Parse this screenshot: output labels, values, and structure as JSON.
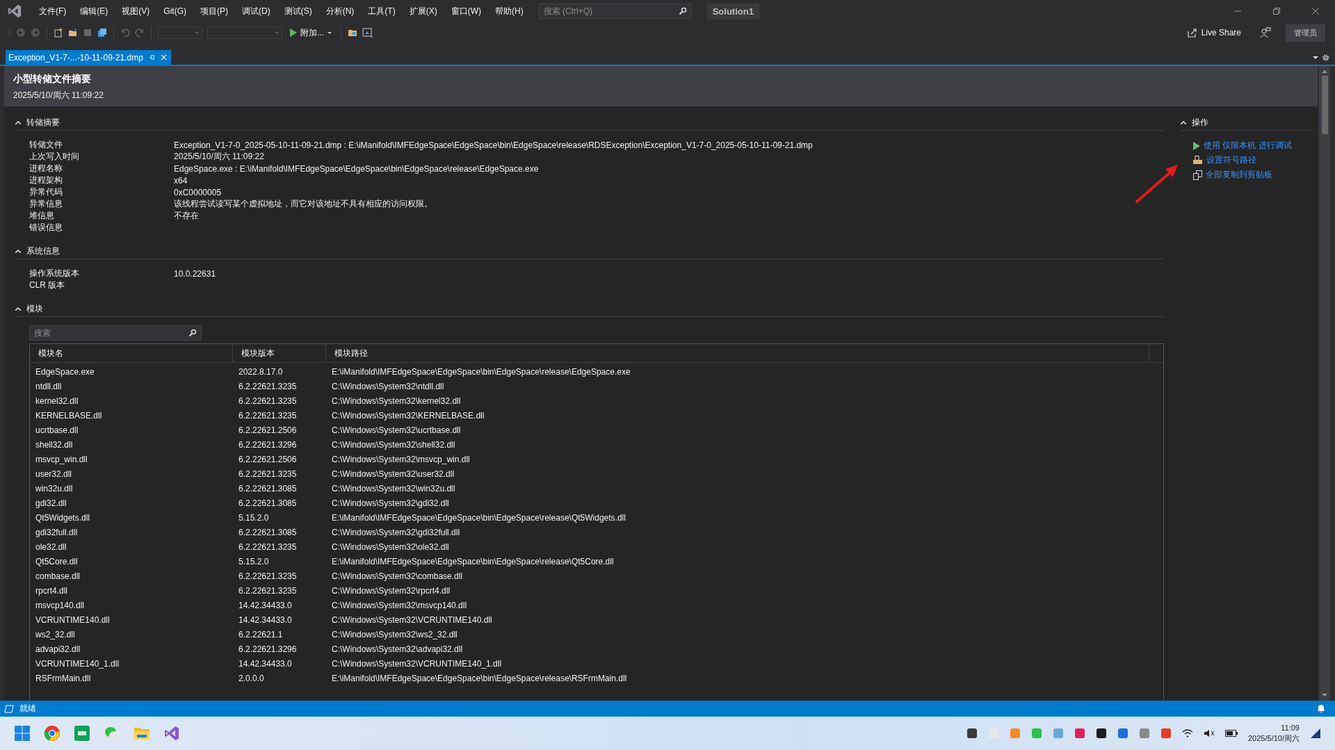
{
  "menu": [
    "文件(F)",
    "编辑(E)",
    "视图(V)",
    "Git(G)",
    "项目(P)",
    "调试(D)",
    "测试(S)",
    "分析(N)",
    "工具(T)",
    "扩展(X)",
    "窗口(W)",
    "帮助(H)"
  ],
  "search": {
    "placeholder": "搜索 (Ctrl+Q)"
  },
  "solution": "Solution1",
  "toolbar": {
    "attach": "附加..."
  },
  "live_share": "Live Share",
  "admin": "管理员",
  "tabs": [
    {
      "label": "Exception_V1-7-...-10-11-09-21.dmp",
      "selected": true
    }
  ],
  "header": {
    "title": "小型转储文件摘要",
    "time": "2025/5/10/周六 11:09:22"
  },
  "sections": [
    {
      "title": "转储摘要",
      "expanded": true,
      "fields": [
        {
          "label": "转储文件",
          "value": "Exception_V1-7-0_2025-05-10-11-09-21.dmp : E:\\iManifold\\IMFEdgeSpace\\EdgeSpace\\bin\\EdgeSpace\\release\\RDSException\\Exception_V1-7-0_2025-05-10-11-09-21.dmp"
        },
        {
          "label": "上次写入时间",
          "value": "2025/5/10/周六 11:09:22"
        },
        {
          "label": "进程名称",
          "value": "EdgeSpace.exe : E:\\iManifold\\IMFEdgeSpace\\EdgeSpace\\bin\\EdgeSpace\\release\\EdgeSpace.exe"
        },
        {
          "label": "进程架构",
          "value": "x64"
        },
        {
          "label": "异常代码",
          "value": "0xC0000005"
        },
        {
          "label": "异常信息",
          "value": "该线程尝试读写某个虚拟地址，而它对该地址不具有相应的访问权限。"
        },
        {
          "label": "堆信息",
          "value": "不存在"
        },
        {
          "label": "错误信息"
        }
      ]
    },
    {
      "title": "系统信息",
      "expanded": true,
      "fields": [
        {
          "label": "操作系统版本",
          "value": "10.0.22631"
        },
        {
          "label": "CLR 版本"
        }
      ]
    }
  ],
  "modules": {
    "title": "模块",
    "expanded": true,
    "search_placeholder": "搜索",
    "columns": [
      "模块名",
      "模块版本",
      "模块路径"
    ],
    "rows": [
      [
        "EdgeSpace.exe",
        "2022.8.17.0",
        "E:\\iManifold\\IMFEdgeSpace\\EdgeSpace\\bin\\EdgeSpace\\release\\EdgeSpace.exe"
      ],
      [
        "ntdll.dll",
        "6.2.22621.3235",
        "C:\\Windows\\System32\\ntdll.dll"
      ],
      [
        "kernel32.dll",
        "6.2.22621.3235",
        "C:\\Windows\\System32\\kernel32.dll"
      ],
      [
        "KERNELBASE.dll",
        "6.2.22621.3235",
        "C:\\Windows\\System32\\KERNELBASE.dll"
      ],
      [
        "ucrtbase.dll",
        "6.2.22621.2506",
        "C:\\Windows\\System32\\ucrtbase.dll"
      ],
      [
        "shell32.dll",
        "6.2.22621.3296",
        "C:\\Windows\\System32\\shell32.dll"
      ],
      [
        "msvcp_win.dll",
        "6.2.22621.2506",
        "C:\\Windows\\System32\\msvcp_win.dll"
      ],
      [
        "user32.dll",
        "6.2.22621.3235",
        "C:\\Windows\\System32\\user32.dll"
      ],
      [
        "win32u.dll",
        "6.2.22621.3085",
        "C:\\Windows\\System32\\win32u.dll"
      ],
      [
        "gdi32.dll",
        "6.2.22621.3085",
        "C:\\Windows\\System32\\gdi32.dll"
      ],
      [
        "Qt5Widgets.dll",
        "5.15.2.0",
        "E:\\iManifold\\IMFEdgeSpace\\EdgeSpace\\bin\\EdgeSpace\\release\\Qt5Widgets.dll"
      ],
      [
        "gdi32full.dll",
        "6.2.22621.3085",
        "C:\\Windows\\System32\\gdi32full.dll"
      ],
      [
        "ole32.dll",
        "6.2.22621.3235",
        "C:\\Windows\\System32\\ole32.dll"
      ],
      [
        "Qt5Core.dll",
        "5.15.2.0",
        "E:\\iManifold\\IMFEdgeSpace\\EdgeSpace\\bin\\EdgeSpace\\release\\Qt5Core.dll"
      ],
      [
        "combase.dll",
        "6.2.22621.3235",
        "C:\\Windows\\System32\\combase.dll"
      ],
      [
        "rpcrt4.dll",
        "6.2.22621.3235",
        "C:\\Windows\\System32\\rpcrt4.dll"
      ],
      [
        "msvcp140.dll",
        "14.42.34433.0",
        "C:\\Windows\\System32\\msvcp140.dll"
      ],
      [
        "VCRUNTIME140.dll",
        "14.42.34433.0",
        "C:\\Windows\\System32\\VCRUNTIME140.dll"
      ],
      [
        "ws2_32.dll",
        "6.2.22621.1",
        "C:\\Windows\\System32\\ws2_32.dll"
      ],
      [
        "advapi32.dll",
        "6.2.22621.3296",
        "C:\\Windows\\System32\\advapi32.dll"
      ],
      [
        "VCRUNTIME140_1.dll",
        "14.42.34433.0",
        "C:\\Windows\\System32\\VCRUNTIME140_1.dll"
      ],
      [
        "RSFrmMain.dll",
        "2.0.0.0",
        "E:\\iManifold\\IMFEdgeSpace\\EdgeSpace\\bin\\EdgeSpace\\release\\RSFrmMain.dll"
      ]
    ]
  },
  "actions": {
    "title": "操作",
    "expanded": true,
    "items": [
      {
        "kind": "debug",
        "label": "使用 仅限本机 进行调试"
      },
      {
        "kind": "symbols",
        "label": "设置符号路径"
      },
      {
        "kind": "copy",
        "label": "全部复制到剪贴板"
      }
    ]
  },
  "status_bar": {
    "text": "就绪"
  },
  "taskbar": {
    "clock_time": "11:09",
    "clock_date": "2025/5/10/周六"
  }
}
